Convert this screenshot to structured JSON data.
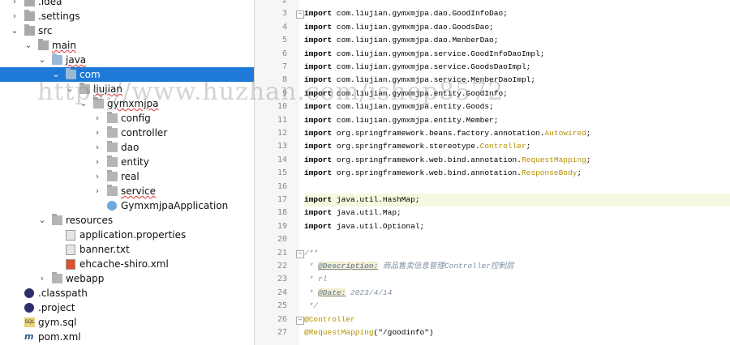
{
  "tree": [
    {
      "indent": 0,
      "arrow": "›",
      "icon": "folder",
      "label": ".idea",
      "name": "tree-item-idea"
    },
    {
      "indent": 0,
      "arrow": "›",
      "icon": "folder",
      "label": ".settings",
      "name": "tree-item-settings"
    },
    {
      "indent": 0,
      "arrow": "⌄",
      "icon": "folder",
      "label": "src",
      "name": "tree-item-src"
    },
    {
      "indent": 1,
      "arrow": "⌄",
      "icon": "folder",
      "label": "main",
      "name": "tree-item-main",
      "squiggle": true
    },
    {
      "indent": 2,
      "arrow": "⌄",
      "icon": "folder-blue",
      "label": "java",
      "name": "tree-item-java",
      "squiggle": true
    },
    {
      "indent": 3,
      "arrow": "⌄",
      "icon": "folder-blue",
      "label": "com",
      "name": "tree-item-com",
      "selected": true
    },
    {
      "indent": 4,
      "arrow": "⌄",
      "icon": "package",
      "label": "liujian",
      "name": "tree-item-liujian",
      "squiggle": true
    },
    {
      "indent": 5,
      "arrow": "⌄",
      "icon": "package",
      "label": "gymxmjpa",
      "name": "tree-item-gymxmjpa",
      "squiggle": true
    },
    {
      "indent": 6,
      "arrow": "›",
      "icon": "package",
      "label": "config",
      "name": "tree-item-config"
    },
    {
      "indent": 6,
      "arrow": "›",
      "icon": "package",
      "label": "controller",
      "name": "tree-item-controller"
    },
    {
      "indent": 6,
      "arrow": "›",
      "icon": "package",
      "label": "dao",
      "name": "tree-item-dao"
    },
    {
      "indent": 6,
      "arrow": "›",
      "icon": "package",
      "label": "entity",
      "name": "tree-item-entity"
    },
    {
      "indent": 6,
      "arrow": "›",
      "icon": "package",
      "label": "real",
      "name": "tree-item-real"
    },
    {
      "indent": 6,
      "arrow": "›",
      "icon": "package",
      "label": "service",
      "name": "tree-item-service",
      "squiggle": true
    },
    {
      "indent": 6,
      "arrow": "",
      "icon": "java-class",
      "label": "GymxmjpaApplication",
      "name": "tree-item-gymxmjpa-application"
    },
    {
      "indent": 2,
      "arrow": "⌄",
      "icon": "package",
      "label": "resources",
      "name": "tree-item-resources"
    },
    {
      "indent": 3,
      "arrow": "",
      "icon": "file",
      "label": "application.properties",
      "name": "tree-item-application-properties"
    },
    {
      "indent": 3,
      "arrow": "",
      "icon": "file",
      "label": "banner.txt",
      "name": "tree-item-banner"
    },
    {
      "indent": 3,
      "arrow": "",
      "icon": "xml",
      "label": "ehcache-shiro.xml",
      "name": "tree-item-ehcache-shiro"
    },
    {
      "indent": 2,
      "arrow": "›",
      "icon": "package",
      "label": "webapp",
      "name": "tree-item-webapp"
    },
    {
      "indent": 0,
      "arrow": "",
      "icon": "eclipse",
      "label": ".classpath",
      "name": "tree-item-classpath"
    },
    {
      "indent": 0,
      "arrow": "",
      "icon": "eclipse",
      "label": ".project",
      "name": "tree-item-project"
    },
    {
      "indent": 0,
      "arrow": "",
      "icon": "sql",
      "label": "gym.sql",
      "name": "tree-item-gym-sql"
    },
    {
      "indent": 0,
      "arrow": "",
      "icon": "maven",
      "label": "pom.xml",
      "name": "tree-item-pom"
    }
  ],
  "code": [
    {
      "num": "2",
      "segments": [
        {
          "t": ""
        }
      ]
    },
    {
      "num": "3",
      "fold": "−",
      "segments": [
        {
          "t": "import",
          "c": "kw"
        },
        {
          "t": " com.liujian.gymxmjpa.dao.GoodInfoDao;"
        }
      ]
    },
    {
      "num": "4",
      "segments": [
        {
          "t": "import",
          "c": "kw"
        },
        {
          "t": " com.liujian.gymxmjpa.dao.GoodsDao;"
        }
      ]
    },
    {
      "num": "5",
      "segments": [
        {
          "t": "import",
          "c": "kw"
        },
        {
          "t": " com.liujian.gymxmjpa.dao.MenberDao;"
        }
      ]
    },
    {
      "num": "6",
      "segments": [
        {
          "t": "import",
          "c": "kw"
        },
        {
          "t": " com.liujian.gymxmjpa.service.GoodInfoDaoImpl;"
        }
      ]
    },
    {
      "num": "7",
      "segments": [
        {
          "t": "import",
          "c": "kw"
        },
        {
          "t": " com.liujian.gymxmjpa.service.GoodsDaoImpl;"
        }
      ]
    },
    {
      "num": "8",
      "segments": [
        {
          "t": "import",
          "c": "kw"
        },
        {
          "t": " com.liujian.gymxmjpa.service.MenberDaoImpl;"
        }
      ]
    },
    {
      "num": "9",
      "segments": [
        {
          "t": "import",
          "c": "kw"
        },
        {
          "t": " com.liujian.gymxmjpa.entity.GoodInfo;"
        }
      ]
    },
    {
      "num": "10",
      "segments": [
        {
          "t": "import",
          "c": "kw"
        },
        {
          "t": " com.liujian.gymxmjpa.entity.Goods;"
        }
      ]
    },
    {
      "num": "11",
      "segments": [
        {
          "t": "import",
          "c": "kw"
        },
        {
          "t": " com.liujian.gymxmjpa.entity.Member;"
        }
      ]
    },
    {
      "num": "12",
      "segments": [
        {
          "t": "import",
          "c": "kw"
        },
        {
          "t": " org.springframework.beans.factory.annotation."
        },
        {
          "t": "Autowired",
          "c": "ann"
        },
        {
          "t": ";"
        }
      ]
    },
    {
      "num": "13",
      "segments": [
        {
          "t": "import",
          "c": "kw"
        },
        {
          "t": " org.springframework.stereotype."
        },
        {
          "t": "Controller",
          "c": "ann"
        },
        {
          "t": ";"
        }
      ]
    },
    {
      "num": "14",
      "segments": [
        {
          "t": "import",
          "c": "kw"
        },
        {
          "t": " org.springframework.web.bind.annotation."
        },
        {
          "t": "RequestMapping",
          "c": "ann"
        },
        {
          "t": ";"
        }
      ]
    },
    {
      "num": "15",
      "segments": [
        {
          "t": "import",
          "c": "kw"
        },
        {
          "t": " org.springframework.web.bind.annotation."
        },
        {
          "t": "ResponseBody",
          "c": "ann"
        },
        {
          "t": ";"
        }
      ]
    },
    {
      "num": "16",
      "segments": [
        {
          "t": ""
        }
      ]
    },
    {
      "num": "17",
      "current": true,
      "segments": [
        {
          "t": "import",
          "c": "kw"
        },
        {
          "t": " java.util.HashMap;"
        }
      ]
    },
    {
      "num": "18",
      "segments": [
        {
          "t": "import",
          "c": "kw"
        },
        {
          "t": " java.util.Map;"
        }
      ]
    },
    {
      "num": "19",
      "segments": [
        {
          "t": "import",
          "c": "kw"
        },
        {
          "t": " java.util.Optional;"
        }
      ]
    },
    {
      "num": "20",
      "segments": [
        {
          "t": ""
        }
      ]
    },
    {
      "num": "21",
      "fold": "−",
      "segments": [
        {
          "t": "/**",
          "c": "cmt"
        }
      ]
    },
    {
      "num": "22",
      "segments": [
        {
          "t": " * ",
          "c": "cmt"
        },
        {
          "t": "@Description:",
          "c": "tag"
        },
        {
          "t": " 商品售卖信息管理Controller控制层",
          "c": "cmt"
        }
      ]
    },
    {
      "num": "23",
      "segments": [
        {
          "t": " * rl",
          "c": "cmt"
        }
      ]
    },
    {
      "num": "24",
      "segments": [
        {
          "t": " * ",
          "c": "cmt"
        },
        {
          "t": "@Date:",
          "c": "tag"
        },
        {
          "t": " 2023/4/14",
          "c": "cmt"
        }
      ]
    },
    {
      "num": "25",
      "segments": [
        {
          "t": " */",
          "c": "cmt"
        }
      ]
    },
    {
      "num": "26",
      "fold": "−",
      "segments": [
        {
          "t": "@Controller",
          "c": "ann"
        }
      ]
    },
    {
      "num": "27",
      "segments": [
        {
          "t": "@RequestMapping",
          "c": "ann"
        },
        {
          "t": "(\"/goodinfo\")",
          "c": "str"
        }
      ]
    }
  ],
  "watermark": "https://www.huzhan.com/ishop8572"
}
